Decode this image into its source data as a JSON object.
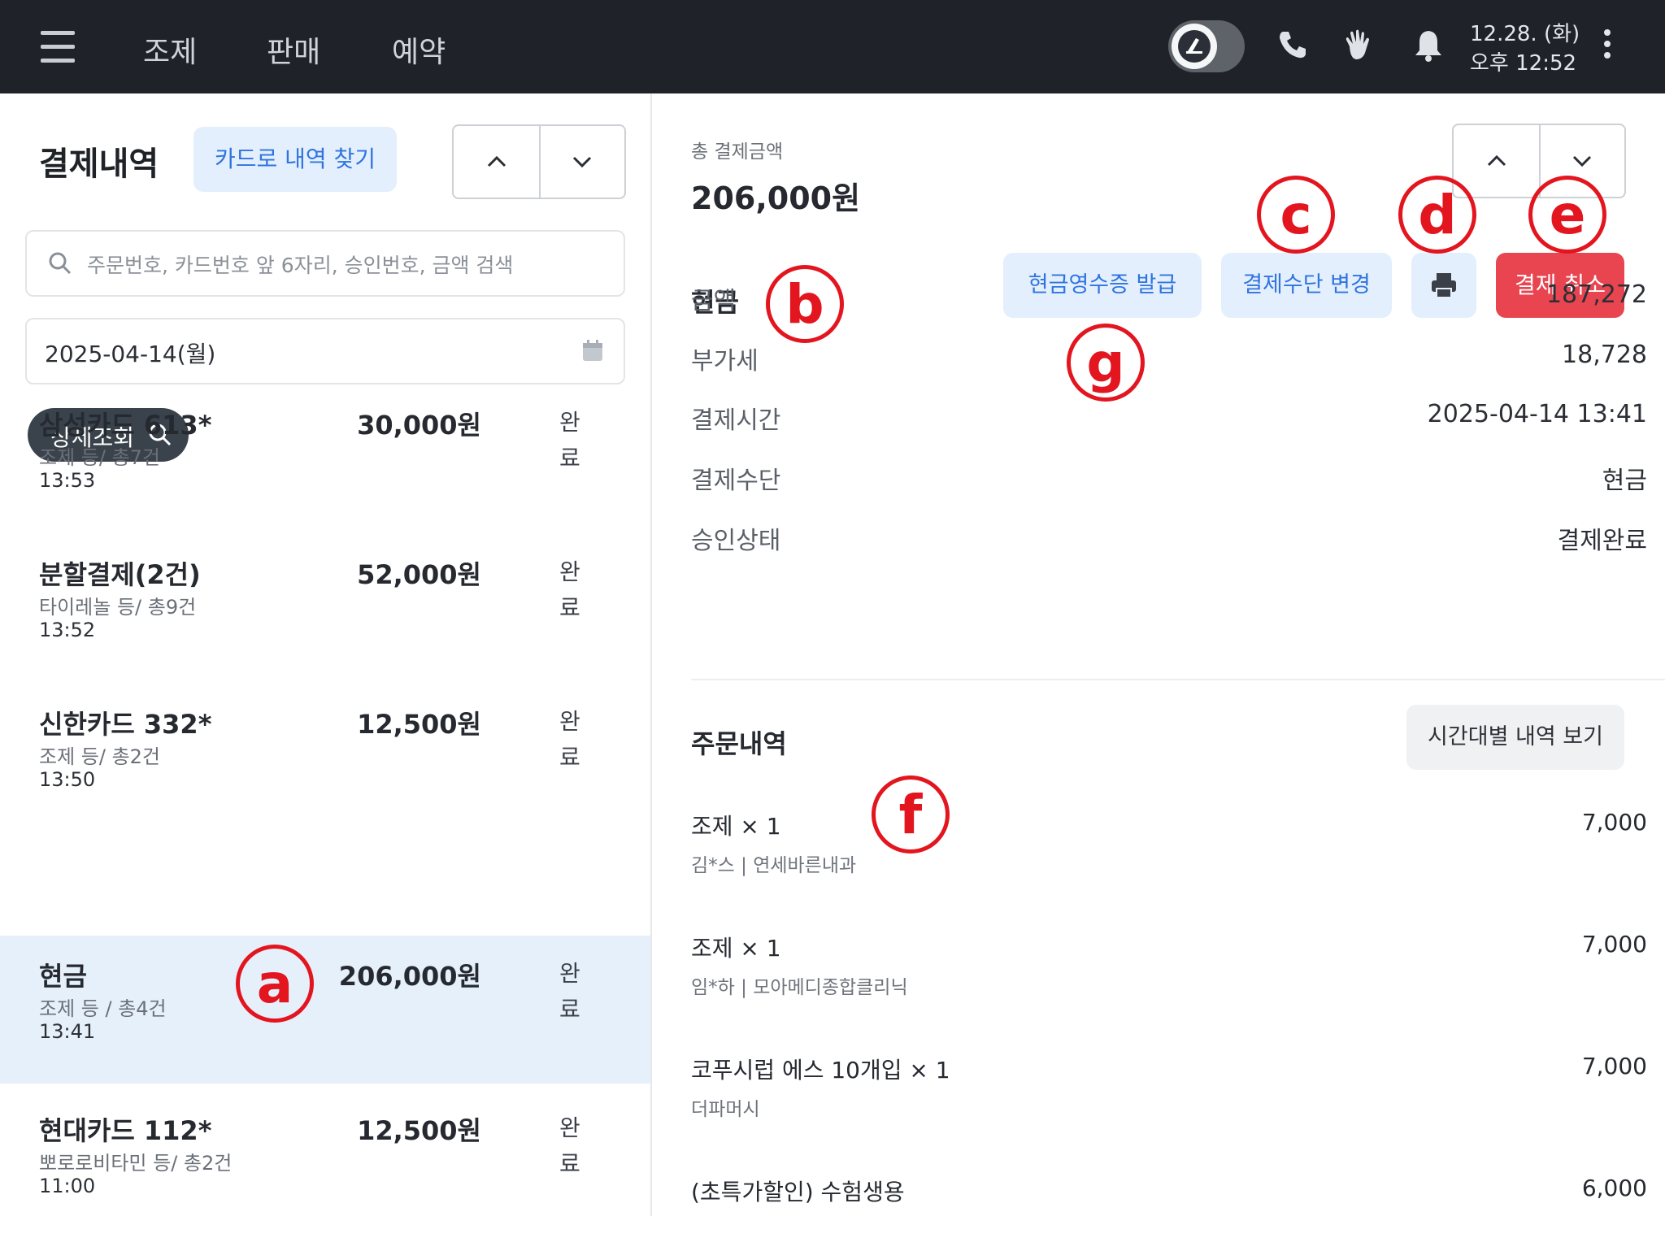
{
  "topbar": {
    "nav": [
      "조제",
      "판매",
      "예약"
    ],
    "date": "12.28. (화)",
    "time": "오후 12:52",
    "icons": [
      "menu-icon",
      "night-mode-toggle",
      "phone-icon",
      "hand-icon",
      "bell-icon",
      "more-icon"
    ]
  },
  "left": {
    "title": "결제내역",
    "find_card_label": "카드로 내역 찾기",
    "search_placeholder": "주문번호, 카드번호 앞 6자리, 승인번호, 금액 검색",
    "date_value": "2025-04-14(월)",
    "detail_button": "상세조회",
    "payments": [
      {
        "title": "삼성카드 613*",
        "sub": "조제 등/ 총7건",
        "time": "13:53",
        "amount": "30,000원",
        "status": "완료",
        "selected": false
      },
      {
        "title": "분할결제(2건)",
        "sub": "타이레놀 등/ 총9건",
        "time": "13:52",
        "amount": "52,000원",
        "status": "완료",
        "selected": false
      },
      {
        "title": "신한카드 332*",
        "sub": "조제 등/ 총2건",
        "time": "13:50",
        "amount": "12,500원",
        "status": "완료",
        "selected": false
      },
      {
        "title": "현금",
        "sub": "조제 등 / 총4건",
        "time": "13:41",
        "amount": "206,000원",
        "status": "완료",
        "selected": true
      },
      {
        "title": "현대카드 112*",
        "sub": "뽀로로비타민 등/ 총2건",
        "time": "11:00",
        "amount": "12,500원",
        "status": "완료",
        "selected": false
      }
    ]
  },
  "right": {
    "total_label": "총 결제금액",
    "total_amount": "206,000원",
    "method_heading": "현금",
    "buttons": {
      "cash_receipt": "현금영수증 발급",
      "change_method": "결제수단 변경",
      "cancel": "결제 취소"
    },
    "details": [
      {
        "label": "금액",
        "value": "187,272"
      },
      {
        "label": "부가세",
        "value": "18,728"
      },
      {
        "label": "결제시간",
        "value": "2025-04-14 13:41"
      },
      {
        "label": "결제수단",
        "value": "현금"
      },
      {
        "label": "승인상태",
        "value": "결제완료"
      }
    ],
    "orders_heading": "주문내역",
    "timeline_button": "시간대별 내역 보기",
    "orders": [
      {
        "name": "조제 × 1",
        "sub": "김*스 | 연세바른내과",
        "price": "7,000"
      },
      {
        "name": "조제 × 1",
        "sub": "임*하 | 모아메디종합클리닉",
        "price": "7,000"
      },
      {
        "name": "코푸시럽 에스 10개입 × 1",
        "sub": "더파머시",
        "price": "7,000"
      },
      {
        "name": "(초특가할인) 수험생용",
        "sub": "",
        "price": "6,000"
      }
    ]
  },
  "markers": {
    "a": "a",
    "b": "b",
    "c": "c",
    "d": "d",
    "e": "e",
    "f": "f",
    "g": "g"
  },
  "colors": {
    "accent": "#2f74e0",
    "danger": "#e84550",
    "annotation": "#e3151f",
    "topbar": "#1f2329"
  }
}
